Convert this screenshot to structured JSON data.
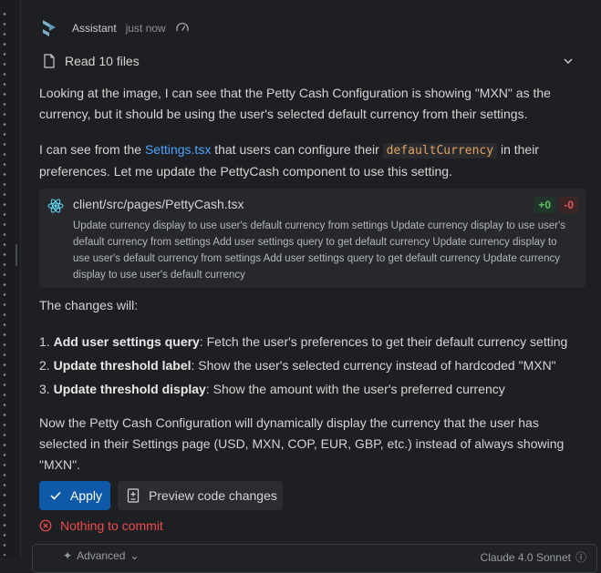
{
  "header": {
    "name": "Assistant",
    "time": "just now"
  },
  "files": {
    "label": "Read 10 files"
  },
  "message": {
    "p1": "Looking at the image, I can see that the Petty Cash Configuration is showing \"MXN\" as the currency, but it should be using the user's selected default currency from their settings.",
    "p2_a": "I can see from the ",
    "p2_link": "Settings.tsx",
    "p2_b": " that users can configure their ",
    "p2_code": "defaultCurrency",
    "p2_c": " in their preferences. Let me update the PettyCash component to use this setting.",
    "p3": "The changes will:",
    "items": [
      {
        "num": "1. ",
        "title": "Add user settings query",
        "text": ": Fetch the user's preferences to get their default currency setting"
      },
      {
        "num": "2. ",
        "title": "Update threshold label",
        "text": ": Show the user's selected currency instead of hardcoded \"MXN\""
      },
      {
        "num": "3. ",
        "title": "Update threshold display",
        "text": ": Show the amount with the user's preferred currency"
      }
    ],
    "p4": "Now the Petty Cash Configuration will dynamically display the currency that the user has selected in their Settings page (USD, MXN, COP, EUR, GBP, etc.) instead of always showing \"MXN\"."
  },
  "file_card": {
    "path": "client/src/pages/PettyCash.tsx",
    "added": "+0",
    "removed": "-0",
    "description": "Update currency display to use user's default currency from settings Update currency display to use user's default currency from settings Add user settings query to get default currency Update currency display to use user's default currency from settings Add user settings query to get default currency Update currency display to use user's default currency"
  },
  "buttons": {
    "apply": "Apply",
    "preview": "Preview code changes"
  },
  "status": {
    "warning": "Nothing to commit"
  },
  "footer": {
    "advanced": "Advanced",
    "model": "Claude 4.0 Sonnet"
  },
  "colors": {
    "accent": "#0e5aa8",
    "link": "#4fa3ff",
    "error": "#f04c4c",
    "added": "#5fc25f",
    "removed": "#e05a5a"
  }
}
